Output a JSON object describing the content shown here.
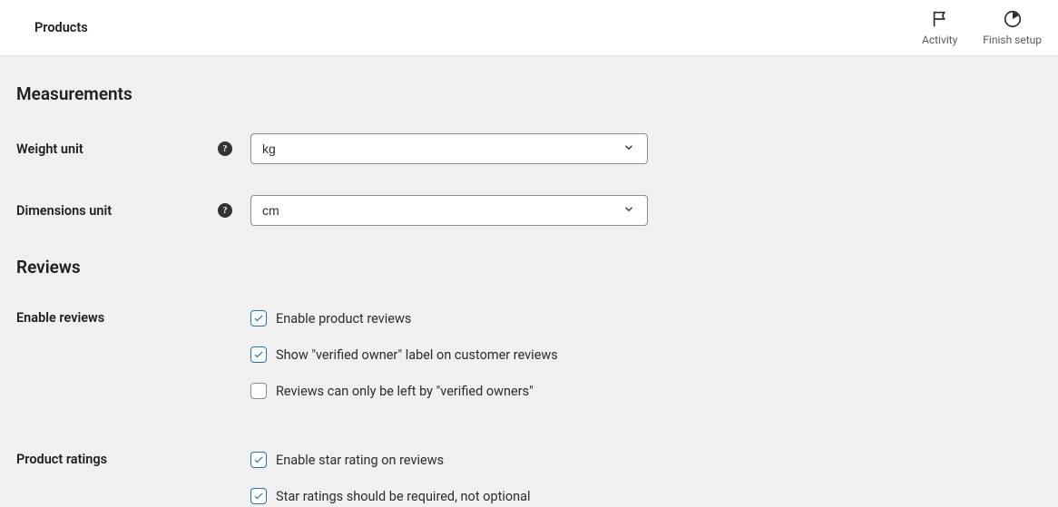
{
  "header": {
    "title": "Products",
    "activity_label": "Activity",
    "finish_setup_label": "Finish setup"
  },
  "sections": {
    "measurements": {
      "heading": "Measurements",
      "weight": {
        "label": "Weight unit",
        "value": "kg"
      },
      "dimensions": {
        "label": "Dimensions unit",
        "value": "cm"
      }
    },
    "reviews": {
      "heading": "Reviews",
      "enable_reviews": {
        "label": "Enable reviews",
        "options": [
          {
            "text": "Enable product reviews",
            "checked": true
          },
          {
            "text": "Show \"verified owner\" label on customer reviews",
            "checked": true
          },
          {
            "text": "Reviews can only be left by \"verified owners\"",
            "checked": false
          }
        ]
      },
      "product_ratings": {
        "label": "Product ratings",
        "options": [
          {
            "text": "Enable star rating on reviews",
            "checked": true
          },
          {
            "text": "Star ratings should be required, not optional",
            "checked": true
          }
        ]
      }
    }
  }
}
